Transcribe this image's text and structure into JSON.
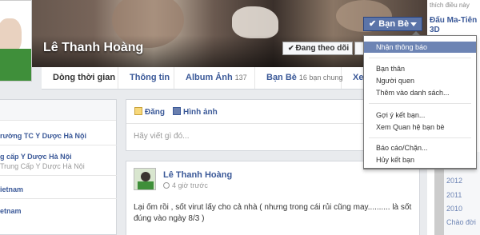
{
  "profile": {
    "name": "Lê Thanh Hoàng",
    "follow_label": "Đang theo dõi",
    "friend_button": "Bạn Bè"
  },
  "tabs": [
    {
      "label": "Dòng thời gian"
    },
    {
      "label": "Thông tin"
    },
    {
      "label": "Album Ảnh",
      "count": "137"
    },
    {
      "label": "Bạn Bè",
      "count": "16 bạn chung"
    },
    {
      "label": "Xe"
    }
  ],
  "left_column": {
    "items": [
      {
        "title": "rường TC Y Dược Hà Nội"
      },
      {
        "title": "g cấp Y Dược Hà Nội",
        "sub": "Trung Cấp Y Dược Hà Nội"
      },
      {
        "title": "ietnam"
      },
      {
        "title": "etnam"
      }
    ]
  },
  "composer": {
    "status_label": "Đăng",
    "photo_label": "Hình ảnh",
    "placeholder": "Hãy viết gì đó..."
  },
  "post": {
    "author": "Lê Thanh Hoàng",
    "time": "4 giờ trước",
    "text": "Lại ốm rồi , sốt virut lấy cho cả nhà ( nhưng trong cái rủi cũng may.......... là sốt đúng vào ngày 8/3 )"
  },
  "right_sidebar": {
    "note": "thích điều này",
    "link1": "Đấu Ma-Tiên",
    "link2": "3D",
    "years": [
      "2012",
      "2011",
      "2010",
      "Chào đời"
    ]
  },
  "dropdown": {
    "items": [
      {
        "label": "Nhận thông báo",
        "highlighted": true
      },
      {
        "label": "Bạn thân"
      },
      {
        "label": "Người quen"
      },
      {
        "label": "Thêm vào danh sách..."
      },
      {
        "label": "Gợi ý kết bạn..."
      },
      {
        "label": "Xem Quan hệ bạn bè"
      },
      {
        "label": "Báo cáo/Chặn..."
      },
      {
        "label": "Hủy kết bạn"
      }
    ]
  }
}
